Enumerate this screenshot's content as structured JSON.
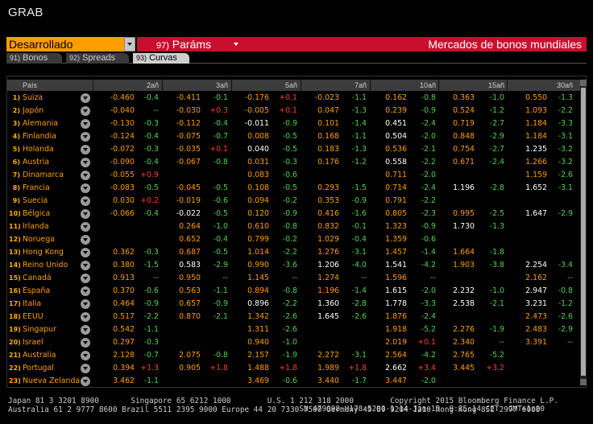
{
  "app": {
    "title": "GRAB"
  },
  "command": {
    "selection": "Desarrollado",
    "params_num": "97)",
    "params_label": "Paráms",
    "screen_title": "Mercados de bonos mundiales"
  },
  "tabs": [
    {
      "num": "91)",
      "label": "Bonos",
      "active": false
    },
    {
      "num": "92)",
      "label": "Spreads",
      "active": false
    },
    {
      "num": "93)",
      "label": "Curvas",
      "active": true
    }
  ],
  "table": {
    "country_header": "País",
    "columns": [
      "2añ",
      "3añ",
      "5añ",
      "7añ",
      "10añ",
      "15añ",
      "30añ"
    ],
    "rows": [
      {
        "n": "1)",
        "country": "Suiza",
        "c": [
          [
            "-0.460",
            "-0.4",
            "o",
            "g"
          ],
          [
            "-0.411",
            "-0.1",
            "o",
            "g"
          ],
          [
            "-0.176",
            "+0.1",
            "o",
            "r"
          ],
          [
            "-0.023",
            "-1.1",
            "o",
            "g"
          ],
          [
            "0.162",
            "-0.8",
            "o",
            "g"
          ],
          [
            "0.363",
            "-1.0",
            "o",
            "g"
          ],
          [
            "0.550",
            "-1.3",
            "o",
            "g"
          ]
        ]
      },
      {
        "n": "2)",
        "country": "Japón",
        "c": [
          [
            "-0.040",
            "--",
            "o",
            "n"
          ],
          [
            "-0.030",
            "+0.3",
            "o",
            "r"
          ],
          [
            "-0.005",
            "+0.1",
            "o",
            "r"
          ],
          [
            "0.047",
            "-1.3",
            "o",
            "g"
          ],
          [
            "0.239",
            "-0.9",
            "o",
            "g"
          ],
          [
            "0.524",
            "-1.2",
            "o",
            "g"
          ],
          [
            "1.093",
            "-2.2",
            "o",
            "g"
          ]
        ]
      },
      {
        "n": "3)",
        "country": "Alemania",
        "c": [
          [
            "-0.130",
            "-0.3",
            "o",
            "g"
          ],
          [
            "-0.112",
            "-0.4",
            "o",
            "g"
          ],
          [
            "-0.011",
            "-0.9",
            "w",
            "g"
          ],
          [
            "0.101",
            "-1.4",
            "o",
            "g"
          ],
          [
            "0.451",
            "-2.4",
            "w",
            "g"
          ],
          [
            "0.719",
            "-2.7",
            "o",
            "g"
          ],
          [
            "1.184",
            "-3.3",
            "o",
            "g"
          ]
        ]
      },
      {
        "n": "4)",
        "country": "Finlandia",
        "c": [
          [
            "-0.124",
            "-0.4",
            "o",
            "g"
          ],
          [
            "-0.075",
            "-0.7",
            "o",
            "g"
          ],
          [
            "0.008",
            "-0.5",
            "o",
            "g"
          ],
          [
            "0.168",
            "-1.1",
            "o",
            "g"
          ],
          [
            "0.504",
            "-2.0",
            "w",
            "g"
          ],
          [
            "0.848",
            "-2.9",
            "o",
            "g"
          ],
          [
            "1.184",
            "-3.1",
            "o",
            "g"
          ]
        ]
      },
      {
        "n": "5)",
        "country": "Holanda",
        "c": [
          [
            "-0.072",
            "-0.3",
            "o",
            "g"
          ],
          [
            "-0.035",
            "+0.1",
            "o",
            "r"
          ],
          [
            "0.040",
            "-0.5",
            "w",
            "g"
          ],
          [
            "0.183",
            "-1.3",
            "o",
            "g"
          ],
          [
            "0.536",
            "-2.1",
            "o",
            "g"
          ],
          [
            "0.754",
            "-2.7",
            "o",
            "g"
          ],
          [
            "1.235",
            "-3.2",
            "w",
            "g"
          ]
        ]
      },
      {
        "n": "6)",
        "country": "Austria",
        "c": [
          [
            "-0.090",
            "-0.4",
            "o",
            "g"
          ],
          [
            "-0.067",
            "-0.8",
            "o",
            "g"
          ],
          [
            "0.031",
            "-0.3",
            "o",
            "g"
          ],
          [
            "0.176",
            "-1.2",
            "o",
            "g"
          ],
          [
            "0.558",
            "-2.2",
            "w",
            "g"
          ],
          [
            "0.671",
            "-2.4",
            "o",
            "g"
          ],
          [
            "1.266",
            "-3.2",
            "o",
            "g"
          ]
        ]
      },
      {
        "n": "7)",
        "country": "Dinamarca",
        "c": [
          [
            "-0.055",
            "+0.9",
            "o",
            "r"
          ],
          [
            "",
            "",
            "o",
            "g"
          ],
          [
            "0.083",
            "-0.6",
            "o",
            "g"
          ],
          [
            "",
            "",
            "o",
            "g"
          ],
          [
            "0.711",
            "-2.0",
            "o",
            "g"
          ],
          [
            "",
            "",
            "o",
            "g"
          ],
          [
            "1.159",
            "-2.6",
            "o",
            "g"
          ]
        ]
      },
      {
        "n": "8)",
        "country": "Francia",
        "c": [
          [
            "-0.083",
            "-0.5",
            "o",
            "g"
          ],
          [
            "-0.045",
            "-0.5",
            "o",
            "g"
          ],
          [
            "0.108",
            "-0.5",
            "o",
            "g"
          ],
          [
            "0.293",
            "-1.5",
            "o",
            "g"
          ],
          [
            "0.714",
            "-2.4",
            "o",
            "g"
          ],
          [
            "1.196",
            "-2.8",
            "w",
            "g"
          ],
          [
            "1.652",
            "-3.1",
            "w",
            "g"
          ]
        ]
      },
      {
        "n": "9)",
        "country": "Suecia",
        "c": [
          [
            "0.030",
            "+0.2",
            "o",
            "r"
          ],
          [
            "-0.019",
            "-0.6",
            "o",
            "g"
          ],
          [
            "0.094",
            "-0.2",
            "o",
            "g"
          ],
          [
            "0.353",
            "-0.9",
            "o",
            "g"
          ],
          [
            "0.791",
            "-2.2",
            "o",
            "g"
          ],
          [
            "",
            "",
            "o",
            "g"
          ],
          [
            "",
            "",
            "o",
            "g"
          ]
        ]
      },
      {
        "n": "10)",
        "country": "Bélgica",
        "c": [
          [
            "-0.066",
            "-0.4",
            "o",
            "g"
          ],
          [
            "-0.022",
            "-0.5",
            "w",
            "g"
          ],
          [
            "0.120",
            "-0.9",
            "o",
            "g"
          ],
          [
            "0.416",
            "-1.6",
            "o",
            "g"
          ],
          [
            "0.805",
            "-2.3",
            "o",
            "g"
          ],
          [
            "0.995",
            "-2.5",
            "o",
            "g"
          ],
          [
            "1.647",
            "-2.9",
            "w",
            "g"
          ]
        ]
      },
      {
        "n": "11)",
        "country": "Irlanda",
        "c": [
          [
            "",
            "",
            "o",
            "g"
          ],
          [
            "0.264",
            "-1.0",
            "o",
            "g"
          ],
          [
            "0.610",
            "-0.8",
            "o",
            "g"
          ],
          [
            "0.832",
            "-0.1",
            "o",
            "g"
          ],
          [
            "1.323",
            "-0.9",
            "o",
            "g"
          ],
          [
            "1.730",
            "-1.3",
            "w",
            "g"
          ],
          [
            "",
            "",
            "o",
            "g"
          ]
        ]
      },
      {
        "n": "12)",
        "country": "Noruega",
        "c": [
          [
            "",
            "",
            "o",
            "g"
          ],
          [
            "0.652",
            "-0.4",
            "o",
            "g"
          ],
          [
            "0.799",
            "-0.2",
            "o",
            "g"
          ],
          [
            "1.029",
            "-0.4",
            "o",
            "g"
          ],
          [
            "1.359",
            "-0.6",
            "o",
            "g"
          ],
          [
            "",
            "",
            "o",
            "g"
          ],
          [
            "",
            "",
            "o",
            "g"
          ]
        ]
      },
      {
        "n": "13)",
        "country": "Hong Kong",
        "c": [
          [
            "0.362",
            "-0.3",
            "o",
            "g"
          ],
          [
            "0.687",
            "-0.5",
            "o",
            "g"
          ],
          [
            "1.014",
            "-2.2",
            "o",
            "g"
          ],
          [
            "1.276",
            "-3.1",
            "o",
            "g"
          ],
          [
            "1.457",
            "-1.4",
            "o",
            "g"
          ],
          [
            "1.664",
            "-1.8",
            "o",
            "g"
          ],
          [
            "",
            "",
            "o",
            "g"
          ]
        ]
      },
      {
        "n": "14)",
        "country": "Reino Unido",
        "c": [
          [
            "0.380",
            "-1.5",
            "o",
            "g"
          ],
          [
            "0.583",
            "-2.9",
            "w",
            "g"
          ],
          [
            "0.990",
            "-3.6",
            "o",
            "g"
          ],
          [
            "1.206",
            "-4.0",
            "w",
            "g"
          ],
          [
            "1.541",
            "-4.2",
            "w",
            "g"
          ],
          [
            "1.903",
            "-3.8",
            "o",
            "g"
          ],
          [
            "2.254",
            "-3.4",
            "w",
            "g"
          ]
        ]
      },
      {
        "n": "15)",
        "country": "Canadá",
        "c": [
          [
            "0.913",
            "--",
            "o",
            "n"
          ],
          [
            "0.950",
            "--",
            "o",
            "n"
          ],
          [
            "1.145",
            "--",
            "o",
            "n"
          ],
          [
            "1.274",
            "--",
            "o",
            "n"
          ],
          [
            "1.596",
            "--",
            "o",
            "n"
          ],
          [
            "",
            "",
            "o",
            "g"
          ],
          [
            "2.162",
            "--",
            "o",
            "n"
          ]
        ]
      },
      {
        "n": "16)",
        "country": "España",
        "c": [
          [
            "0.370",
            "-0.6",
            "o",
            "g"
          ],
          [
            "0.563",
            "-1.1",
            "o",
            "g"
          ],
          [
            "0.894",
            "-0.8",
            "o",
            "g"
          ],
          [
            "1.196",
            "-1.4",
            "o",
            "g"
          ],
          [
            "1.615",
            "-2.0",
            "w",
            "g"
          ],
          [
            "2.232",
            "-1.0",
            "w",
            "g"
          ],
          [
            "2.947",
            "-0.8",
            "w",
            "g"
          ]
        ]
      },
      {
        "n": "17)",
        "country": "Italia",
        "c": [
          [
            "0.464",
            "-0.9",
            "o",
            "g"
          ],
          [
            "0.657",
            "-0.9",
            "o",
            "g"
          ],
          [
            "0.896",
            "-2.2",
            "w",
            "g"
          ],
          [
            "1.360",
            "-2.8",
            "w",
            "g"
          ],
          [
            "1.778",
            "-3.3",
            "w",
            "g"
          ],
          [
            "2.538",
            "-2.1",
            "w",
            "g"
          ],
          [
            "3.231",
            "-1.2",
            "w",
            "g"
          ]
        ]
      },
      {
        "n": "18)",
        "country": "EEUU",
        "c": [
          [
            "0.517",
            "-2.2",
            "o",
            "g"
          ],
          [
            "0.870",
            "-2.1",
            "o",
            "g"
          ],
          [
            "1.342",
            "-2.6",
            "o",
            "g"
          ],
          [
            "1.645",
            "-2.6",
            "w",
            "g"
          ],
          [
            "1.876",
            "-2.4",
            "o",
            "g"
          ],
          [
            "",
            "",
            "o",
            "g"
          ],
          [
            "2.473",
            "-2.6",
            "o",
            "g"
          ]
        ]
      },
      {
        "n": "19)",
        "country": "Singapur",
        "c": [
          [
            "0.542",
            "-1.1",
            "o",
            "g"
          ],
          [
            "",
            "",
            "o",
            "g"
          ],
          [
            "1.311",
            "-2.6",
            "o",
            "g"
          ],
          [
            "",
            "",
            "o",
            "g"
          ],
          [
            "1.918",
            "-5.2",
            "o",
            "g"
          ],
          [
            "2.276",
            "-1.9",
            "o",
            "g"
          ],
          [
            "2.483",
            "-2.9",
            "o",
            "g"
          ]
        ]
      },
      {
        "n": "20)",
        "country": "Israel",
        "c": [
          [
            "0.297",
            "-0.3",
            "o",
            "g"
          ],
          [
            "",
            "",
            "o",
            "g"
          ],
          [
            "0.940",
            "-1.0",
            "o",
            "g"
          ],
          [
            "",
            "",
            "o",
            "g"
          ],
          [
            "2.019",
            "+0.1",
            "o",
            "r"
          ],
          [
            "2.340",
            "--",
            "o",
            "n"
          ],
          [
            "3.391",
            "--",
            "o",
            "n"
          ]
        ]
      },
      {
        "n": "21)",
        "country": "Australia",
        "c": [
          [
            "2.128",
            "-0.7",
            "o",
            "g"
          ],
          [
            "2.075",
            "-0.8",
            "o",
            "g"
          ],
          [
            "2.157",
            "-1.9",
            "o",
            "g"
          ],
          [
            "2.272",
            "-3.1",
            "o",
            "g"
          ],
          [
            "2.564",
            "-4.2",
            "o",
            "g"
          ],
          [
            "2.765",
            "-5.2",
            "o",
            "g"
          ],
          [
            "",
            "",
            "o",
            "g"
          ]
        ]
      },
      {
        "n": "22)",
        "country": "Portugal",
        "c": [
          [
            "0.394",
            "+1.3",
            "o",
            "r"
          ],
          [
            "0.905",
            "+1.8",
            "o",
            "r"
          ],
          [
            "1.488",
            "+1.8",
            "o",
            "r"
          ],
          [
            "1.989",
            "+1.8",
            "o",
            "r"
          ],
          [
            "2.662",
            "+3.4",
            "w",
            "r"
          ],
          [
            "3.445",
            "+3.2",
            "o",
            "r"
          ],
          [
            "",
            "",
            "o",
            "g"
          ]
        ]
      },
      {
        "n": "23)",
        "country": "Nueva Zelanda",
        "c": [
          [
            "3.462",
            "-1.1",
            "o",
            "g"
          ],
          [
            "",
            "",
            "o",
            "g"
          ],
          [
            "3.469",
            "-0.6",
            "o",
            "g"
          ],
          [
            "3.440",
            "-1.7",
            "o",
            "g"
          ],
          [
            "3.447",
            "-2.0",
            "o",
            "g"
          ],
          [
            "",
            "",
            "o",
            "g"
          ],
          [
            "",
            "",
            "o",
            "g"
          ]
        ]
      }
    ]
  },
  "footer": {
    "line1": "Australia 61 2 9777 8600 Brazil 5511 2395 9000 Europe 44 20 7330 7500 Germany 49 69 9204 1210 Hong Kong 852 2977 6000",
    "line2": "Japan 81 3 3201 8900       Singapore 65 6212 1000        U.S. 1 212 318 2000        Copyright 2015 Bloomberg Finance L.P.",
    "line3": "                                                                SN 479098 H178-5200-1 14-Jan-15  9:35:14 CET  GMT+1:00"
  }
}
